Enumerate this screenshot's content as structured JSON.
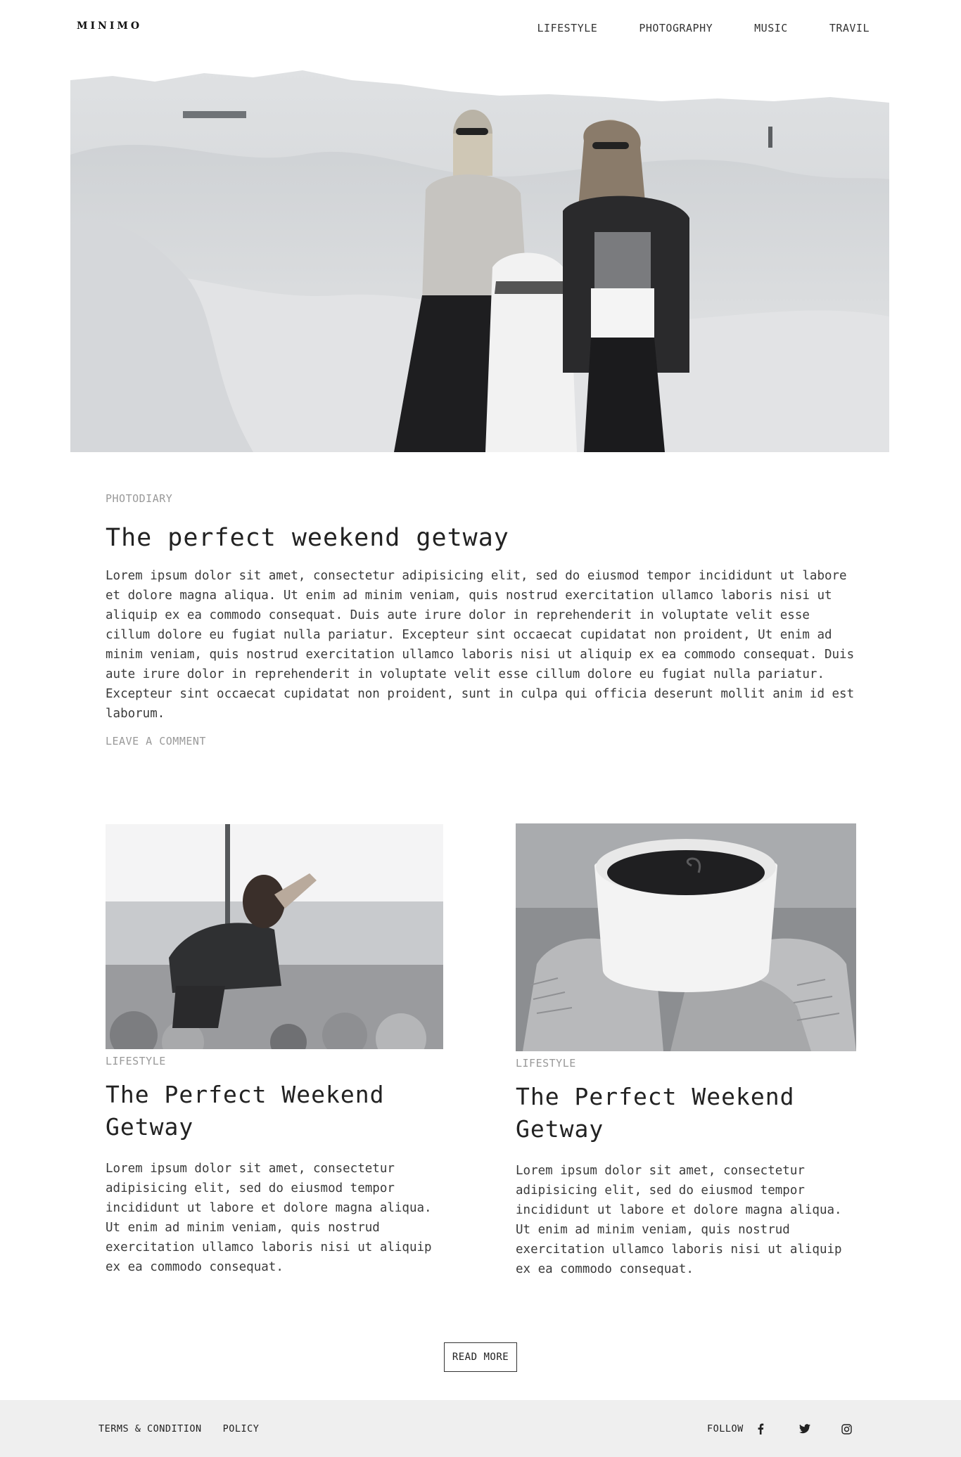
{
  "header": {
    "logo": "MINIMO",
    "nav": [
      "LIFESTYLE",
      "PHOTOGRAPHY",
      "MUSIC",
      "TRAVIL"
    ]
  },
  "featured": {
    "category": "PHOTODIARY",
    "title": "The perfect weekend getway",
    "body": "Lorem ipsum dolor sit amet, consectetur adipisicing elit, sed do eiusmod tempor incididunt ut labore et dolore magna aliqua. Ut enim ad minim veniam, quis nostrud exercitation ullamco laboris nisi ut aliquip ex ea commodo consequat. Duis aute irure dolor in reprehenderit in voluptate velit esse cillum dolore eu fugiat nulla pariatur. Excepteur sint occaecat cupidatat non proident, Ut enim ad minim veniam, quis nostrud exercitation ullamco laboris nisi ut aliquip ex ea commodo consequat. Duis aute irure dolor in reprehenderit in voluptate velit esse cillum dolore eu fugiat nulla pariatur. Excepteur sint occaecat cupidatat non proident, sunt in culpa qui officia deserunt mollit anim id est laborum.",
    "comment_link": "LEAVE A COMMENT"
  },
  "cards": [
    {
      "category": "LIFESTYLE",
      "title": "The Perfect Weekend Getway",
      "body": "Lorem ipsum dolor sit amet, consectetur adipisicing elit, sed do eiusmod tempor incididunt ut labore et dolore magna aliqua. Ut enim ad minim veniam, quis nostrud exercitation ullamco laboris nisi ut aliquip ex ea commodo consequat."
    },
    {
      "category": "LIFESTYLE",
      "title": "The Perfect Weekend Getway",
      "body": "Lorem ipsum dolor sit amet, consectetur adipisicing elit, sed do eiusmod tempor incididunt ut labore et dolore magna aliqua. Ut enim ad minim veniam, quis nostrud exercitation ullamco laboris nisi ut aliquip ex ea commodo consequat."
    }
  ],
  "read_more": "READ MORE",
  "footer": {
    "links": [
      "TERMS & CONDITION",
      "POLICY"
    ],
    "follow": "FOLLOW",
    "social_icons": [
      "facebook-icon",
      "twitter-icon",
      "instagram-icon"
    ]
  }
}
